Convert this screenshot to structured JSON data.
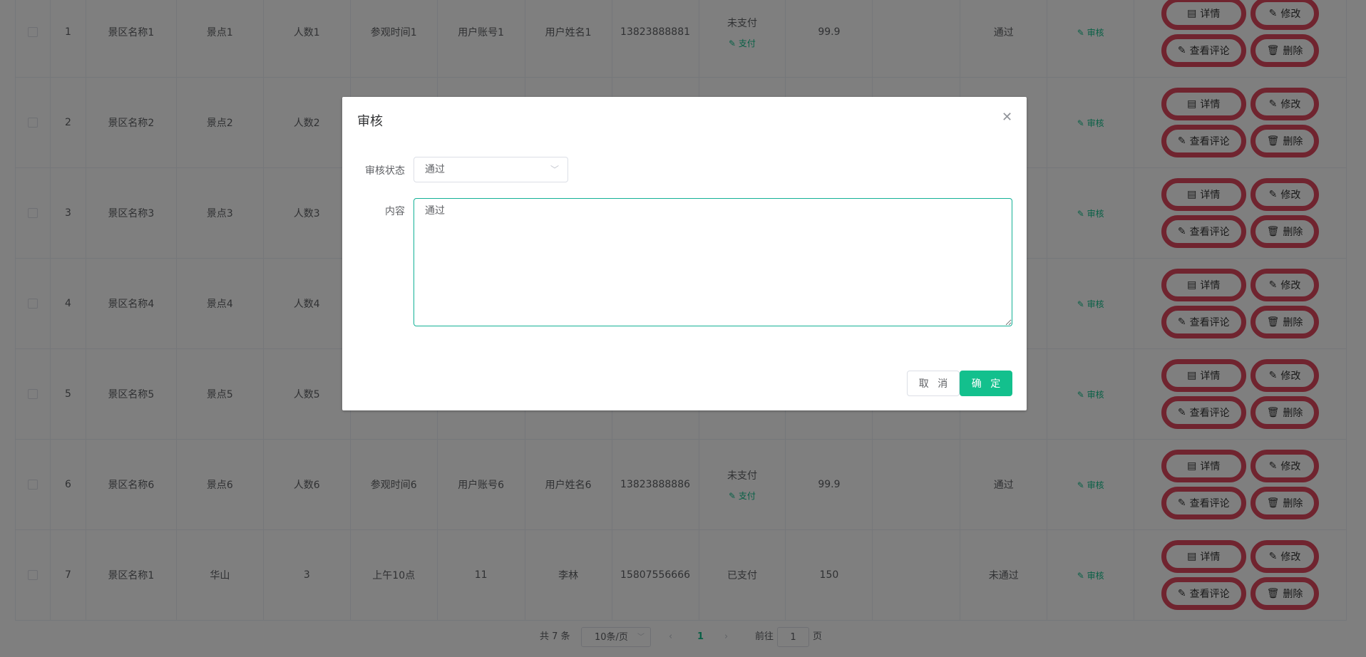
{
  "table": {
    "rows": [
      {
        "index": "1",
        "scenic": "景区名称1",
        "spot": "景点1",
        "people": "人数1",
        "time": "参观时间1",
        "account": "用户账号1",
        "name": "用户姓名1",
        "phone": "13823888881",
        "pay_status": "未支付",
        "pay_link": "支付",
        "price": "99.9",
        "reply": "",
        "audit_status": "通过",
        "audit_link": "审核"
      },
      {
        "index": "2",
        "scenic": "景区名称2",
        "spot": "景点2",
        "people": "人数2",
        "time": "",
        "account": "",
        "name": "",
        "phone": "",
        "pay_status": "",
        "pay_link": "",
        "price": "",
        "reply": "",
        "audit_status": "",
        "audit_link": "审核"
      },
      {
        "index": "3",
        "scenic": "景区名称3",
        "spot": "景点3",
        "people": "人数3",
        "time": "",
        "account": "",
        "name": "",
        "phone": "",
        "pay_status": "",
        "pay_link": "",
        "price": "",
        "reply": "",
        "audit_status": "",
        "audit_link": "审核"
      },
      {
        "index": "4",
        "scenic": "景区名称4",
        "spot": "景点4",
        "people": "人数4",
        "time": "",
        "account": "",
        "name": "",
        "phone": "",
        "pay_status": "",
        "pay_link": "",
        "price": "",
        "reply": "",
        "audit_status": "",
        "audit_link": "审核"
      },
      {
        "index": "5",
        "scenic": "景区名称5",
        "spot": "景点5",
        "people": "人数5",
        "time": "",
        "account": "",
        "name": "",
        "phone": "",
        "pay_status": "",
        "pay_link": "",
        "price": "",
        "reply": "",
        "audit_status": "",
        "audit_link": "审核"
      },
      {
        "index": "6",
        "scenic": "景区名称6",
        "spot": "景点6",
        "people": "人数6",
        "time": "参观时间6",
        "account": "用户账号6",
        "name": "用户姓名6",
        "phone": "13823888886",
        "pay_status": "未支付",
        "pay_link": "支付",
        "price": "99.9",
        "reply": "",
        "audit_status": "通过",
        "audit_link": "审核"
      },
      {
        "index": "7",
        "scenic": "景区名称1",
        "spot": "华山",
        "people": "3",
        "time": "上午10点",
        "account": "11",
        "name": "李林",
        "phone": "15807556666",
        "pay_status": "已支付",
        "pay_link": "",
        "price": "150",
        "reply": "",
        "audit_status": "未通过",
        "audit_link": "审核"
      }
    ],
    "actions": {
      "detail": "详情",
      "edit": "修改",
      "comments": "查看评论",
      "delete": "删除"
    }
  },
  "pagination": {
    "total": "共 7 条",
    "page_size": "10条/页",
    "current": "1",
    "goto_label": "前往",
    "goto_value": "1",
    "page_suffix": "页"
  },
  "modal": {
    "title": "审核",
    "status_label": "审核状态",
    "status_value": "通过",
    "content_label": "内容",
    "content_value": "通过",
    "cancel": "取 消",
    "confirm": "确 定"
  },
  "colors": {
    "accent": "#13c08d",
    "action_ring": "#e0485f"
  }
}
